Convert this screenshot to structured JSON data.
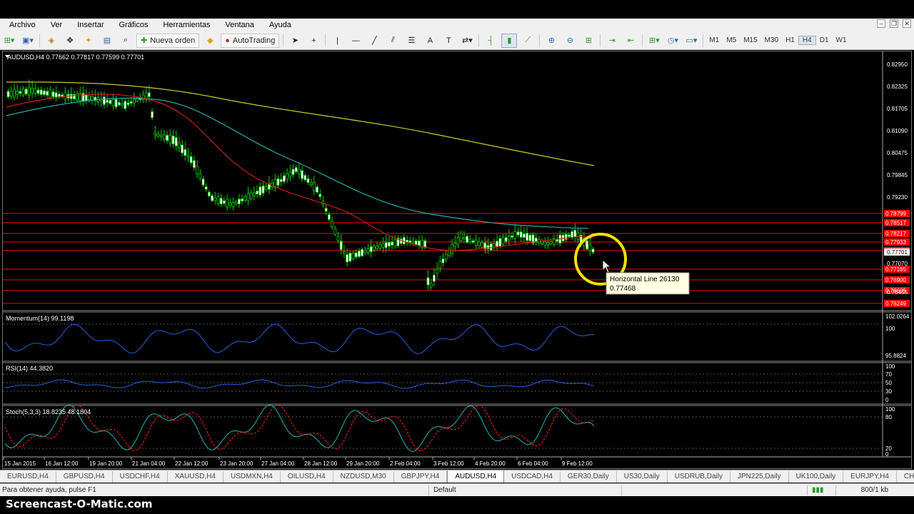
{
  "menu": [
    "Archivo",
    "Ver",
    "Insertar",
    "Gráficos",
    "Herramientas",
    "Ventana",
    "Ayuda"
  ],
  "toolbar": {
    "new_order": "Nueva orden",
    "autotrading": "AutoTrading",
    "timeframes": [
      "M1",
      "M5",
      "M15",
      "M30",
      "H1",
      "H4",
      "D1",
      "W1"
    ],
    "active_tf": "H4"
  },
  "chart": {
    "header": "AUDUSD,H4  0.77662 0.77817 0.77599 0.77701",
    "price_ticks": [
      "0.82950",
      "0.82325",
      "0.81705",
      "0.81090",
      "0.80475",
      "0.79845",
      "0.79230",
      "0.77701",
      "0.77070",
      "0.76455"
    ],
    "red_labels": [
      "0.78799",
      "0.78517",
      "0.78217",
      "0.77933",
      "0.77639",
      "0.77185",
      "0.76900",
      "0.76605",
      "0.76249"
    ],
    "current_price": "0.77701",
    "tooltip": {
      "line1": "Horizontal Line 26130",
      "line2": "0.77468"
    },
    "momentum": {
      "label": "Momentum(14) 99.1198",
      "ticks": [
        "102.0264",
        "100",
        "95.8824"
      ]
    },
    "rsi": {
      "label": "RSI(14) 44.3820",
      "ticks": [
        "100",
        "70",
        "50",
        "30",
        "0"
      ]
    },
    "stoch": {
      "label": "Stoch(5,3,3) 18.8235 48.1804",
      "ticks": [
        "100",
        "80",
        "20",
        "0"
      ]
    },
    "dates": [
      "15 Jan 2015",
      "16 Jan 12:00",
      "19 Jan 20:00",
      "21 Jan 04:00",
      "22 Jan 12:00",
      "23 Jan 20:00",
      "27 Jan 04:00",
      "28 Jan 12:00",
      "29 Jan 20:00",
      "2 Feb 04:00",
      "3 Feb 12:00",
      "4 Feb 20:00",
      "6 Feb 04:00",
      "9 Feb 12:00"
    ],
    "colors": {
      "bull": "#00cc00",
      "ma_red": "#d01818",
      "ma_teal": "#2aa8a8",
      "ma_yellow": "#c8c832",
      "hline": "#ff0000",
      "indicator": "#2860e0",
      "signal": "#ff2020"
    }
  },
  "tabs": [
    "EURUSD,H4",
    "GBPUSD,H4",
    "USDCHF,H4",
    "XAUUSD,H4",
    "USDMXN,H4",
    "OILUSD,H4",
    "NZDUSD,M30",
    "GBPJPY,H4",
    "AUDUSD,H4",
    "USDCAD,H4",
    "GER30,Daily",
    "US30,Daily",
    "USDRUB,Daily",
    "JPN225,Daily",
    "UK100,Daily",
    "EURJPY,H4",
    "CHFJP"
  ],
  "active_tab": "AUDUSD,H4",
  "status": {
    "help": "Para obtener ayuda, pulse F1",
    "profile": "Default",
    "traffic": "800/1 kb"
  },
  "watermark": "Screencast-O-Matic.com"
}
